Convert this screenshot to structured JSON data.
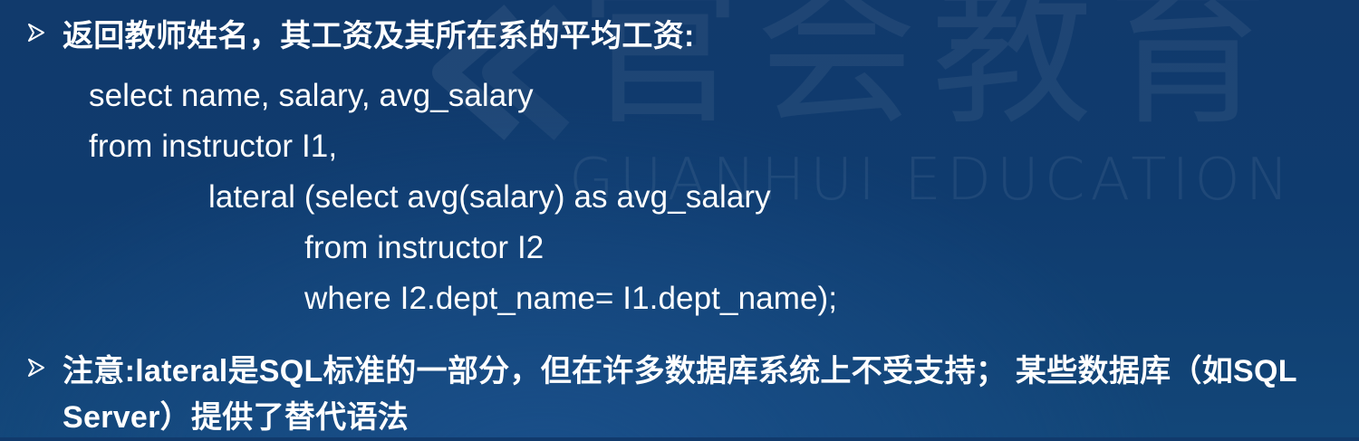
{
  "watermark": {
    "chinese": "官会教育",
    "english": "GUANHUI EDUCATION"
  },
  "bullets": [
    {
      "icon": "arrow-bullet-icon",
      "text": "返回教师姓名，其工资及其所在系的平均工资:"
    },
    {
      "icon": "arrow-bullet-icon",
      "text": "注意:lateral是SQL标准的一部分，但在许多数据库系统上不受支持； 某些数据库（如SQL Server）提供了替代语法"
    }
  ],
  "code": {
    "lines": [
      "select name, salary, avg_salary",
      "from instructor I1,",
      "lateral (select avg(salary) as avg_salary",
      "from instructor I2",
      "where I2.dept_name= I1.dept_name);"
    ]
  },
  "colors": {
    "background": "#113a6c",
    "text": "#ffffff"
  }
}
